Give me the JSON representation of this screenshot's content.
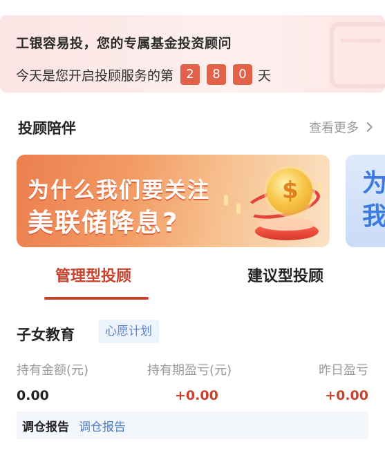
{
  "hero": {
    "title": "工银容易投，您的专属基金投资顾问",
    "days_prefix": "今天是您开启投顾服务的第",
    "digits": [
      "2",
      "8",
      "0"
    ],
    "days_suffix": "天"
  },
  "section": {
    "title": "投顾陪伴",
    "more": "查看更多"
  },
  "banner": {
    "line1": "为什么我们要关注",
    "line2": "美联储降息?",
    "next_line1": "为",
    "next_line2": "我"
  },
  "tabs": [
    {
      "label": "管理型投顾",
      "active": true
    },
    {
      "label": "建议型投顾",
      "active": false
    }
  ],
  "plan": {
    "name": "子女教育",
    "tag": "心愿计划",
    "columns": [
      "持有金额(元)",
      "持有期盈亏(元)",
      "昨日盈亏"
    ],
    "values": [
      "0.00",
      "+0.00",
      "+0.00"
    ],
    "report_label": "调仓报告",
    "report_link": "调仓报告"
  },
  "colors": {
    "accent": "#c8432e",
    "digit_bg": "#e36049",
    "link": "#4a7cc9"
  }
}
